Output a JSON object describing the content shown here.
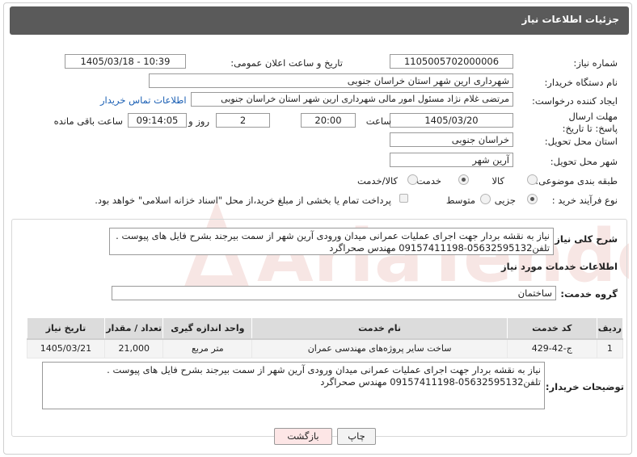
{
  "header": {
    "title": "جزئیات اطلاعات نیاز"
  },
  "form": {
    "need_number_label": "شماره نیاز:",
    "need_number": "1105005702000006",
    "announce_label": "تاریخ و ساعت اعلان عمومی:",
    "announce_value": "1405/03/18 - 10:39",
    "buyer_label": "نام دستگاه خریدار:",
    "buyer_value": "شهرداری ارین شهر استان خراسان جنوبی",
    "creator_label": "ایجاد کننده درخواست:",
    "creator_value": "مرتضی غلام نژاد مسئول امور مالی شهرداری ارین شهر استان خراسان جنوبی",
    "contact_link": "اطلاعات تماس خریدار",
    "deadline_label": "مهلت ارسال پاسخ: تا تاریخ:",
    "deadline_date": "1405/03/20",
    "time_label": "ساعت",
    "deadline_time": "20:00",
    "days_value": "2",
    "days_label": "روز و",
    "remaining_time": "09:14:05",
    "remaining_label": "ساعت باقی مانده",
    "province_label": "استان محل تحویل:",
    "province_value": "خراسان جنوبی",
    "city_label": "شهر محل تحویل:",
    "city_value": "آرین شهر",
    "category_label": "طبقه بندی موضوعی:",
    "category_options": [
      "کالا",
      "خدمت",
      "کالا/خدمت"
    ],
    "category_selected": 1,
    "process_label": "نوع فرآیند خرید :",
    "process_options": [
      "جزیی",
      "متوسط"
    ],
    "process_selected": 0,
    "payment_text": "پرداخت تمام یا بخشی از مبلغ خرید،از محل \"اسناد خزانه اسلامی\" خواهد بود."
  },
  "description": {
    "label": "شرح کلی نیاز:",
    "text": "نیاز به نقشه بردار جهت اجرای عملیات عمرانی میدان ورودی آرین شهر از سمت بیرجند بشرح فایل های پیوست . تلفن05632595132-09157411198 مهندس صحراگرد"
  },
  "services": {
    "section_title": "اطلاعات خدمات مورد نیاز",
    "group_label": "گروه خدمت:",
    "group_value": "ساختمان",
    "columns": [
      "ردیف",
      "کد خدمت",
      "نام خدمت",
      "واحد اندازه گیری",
      "تعداد / مقدار",
      "تاریخ نیاز"
    ],
    "rows": [
      [
        "1",
        "ج-42-429",
        "ساخت سایر پروژه‌های مهندسی عمران",
        "متر مربع",
        "21,000",
        "1405/03/21"
      ]
    ]
  },
  "buyer_notes": {
    "label": "توضیحات خریدار:",
    "text": "نیاز به نقشه بردار جهت اجرای عملیات عمرانی میدان ورودی آرین شهر از سمت بیرجند بشرح فایل های پیوست . تلفن05632595132-09157411198 مهندس صحراگرد"
  },
  "buttons": {
    "print": "چاپ",
    "back": "بازگشت"
  },
  "colors": {
    "title_bg": "#5a5a5a",
    "link": "#1a5fb4",
    "back_bg": "#fde6e6",
    "watermark": "#c0392b"
  }
}
